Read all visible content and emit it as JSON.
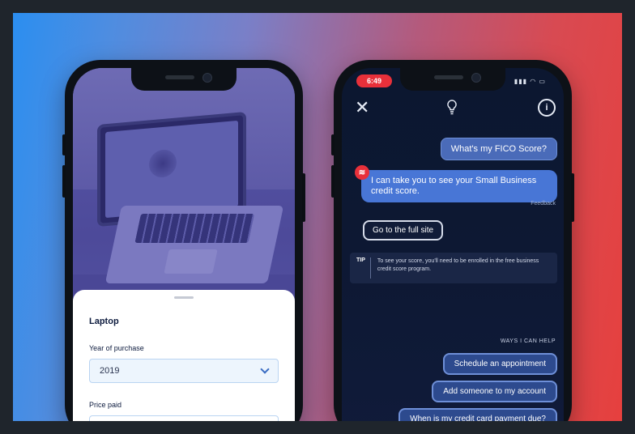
{
  "left_phone": {
    "sheet": {
      "title": "Laptop",
      "year_label": "Year of purchase",
      "year_value": "2019",
      "price_label": "Price paid"
    }
  },
  "right_phone": {
    "status_time": "6:49",
    "user_message": "What's my FICO Score?",
    "bot_message": "I can take you to see your Small Business credit score.",
    "feedback_label": "Feedback",
    "full_site_button": "Go to the full site",
    "tip_tag": "TIP",
    "tip_text": "To see your score, you'll need to be enrolled in the free business credit score program.",
    "ways_heading": "WAYS I CAN HELP",
    "suggestions": [
      "Schedule an appointment",
      "Add someone to my account",
      "When is my credit card payment due?"
    ]
  },
  "icons": [
    "close-icon",
    "lightbulb-icon",
    "info-icon",
    "chevron-down-icon",
    "bank-logo-icon"
  ],
  "colors": {
    "gradient_left": "#2b8ef0",
    "gradient_right": "#e6403e",
    "brand_red": "#e8303a",
    "bot_bubble": "#4876d6",
    "chip_bg": "#2d4a8e"
  }
}
